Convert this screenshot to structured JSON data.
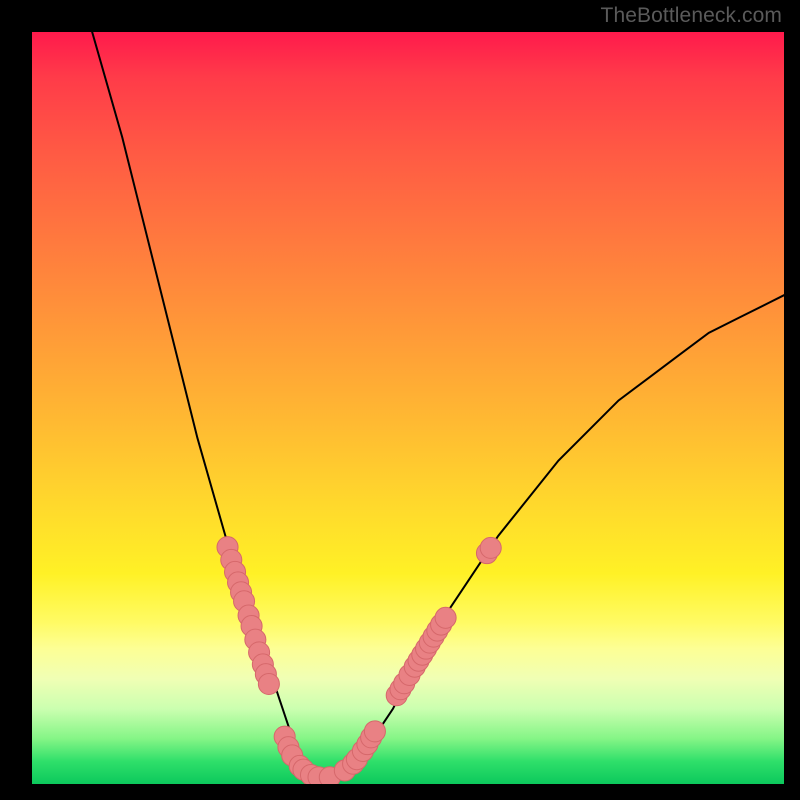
{
  "attribution": "TheBottleneck.com",
  "colors": {
    "frame": "#000000",
    "gradient_top": "#ff1a4c",
    "gradient_mid": "#ffe42a",
    "gradient_bottom": "#0cc95c",
    "curve": "#000000",
    "marker": "#e98184",
    "marker_stroke": "#d6686b"
  },
  "chart_data": {
    "type": "line",
    "title": "",
    "xlabel": "",
    "ylabel": "",
    "xlim": [
      0,
      100
    ],
    "ylim": [
      0,
      100
    ],
    "grid": false,
    "series": [
      {
        "name": "bottleneck-curve",
        "x": [
          8,
          10,
          12,
          14,
          16,
          18,
          20,
          22,
          24,
          26,
          27,
          28,
          29,
          30,
          31,
          32,
          33,
          34,
          35,
          36,
          37,
          38,
          39,
          40,
          42,
          44,
          46,
          48,
          50,
          54,
          58,
          62,
          66,
          70,
          74,
          78,
          82,
          86,
          90,
          94,
          98,
          100
        ],
        "y": [
          100,
          93,
          86,
          78,
          70,
          62,
          54,
          46,
          39,
          32,
          29,
          26,
          23,
          20,
          17,
          14,
          11,
          8,
          5,
          3,
          2,
          1,
          1,
          1,
          2,
          4,
          7,
          10,
          14,
          21,
          27,
          33,
          38,
          43,
          47,
          51,
          54,
          57,
          60,
          62,
          64,
          65
        ]
      }
    ],
    "markers": {
      "series_ref": "bottleneck-curve",
      "points": [
        {
          "x": 26.0,
          "y": 31.5,
          "r": 1.4
        },
        {
          "x": 26.5,
          "y": 29.8,
          "r": 1.4
        },
        {
          "x": 27.0,
          "y": 28.2,
          "r": 1.4
        },
        {
          "x": 27.4,
          "y": 26.8,
          "r": 1.4
        },
        {
          "x": 27.8,
          "y": 25.5,
          "r": 1.4
        },
        {
          "x": 28.2,
          "y": 24.3,
          "r": 1.4
        },
        {
          "x": 28.8,
          "y": 22.4,
          "r": 1.4
        },
        {
          "x": 29.2,
          "y": 21.0,
          "r": 1.4
        },
        {
          "x": 29.7,
          "y": 19.2,
          "r": 1.4
        },
        {
          "x": 30.2,
          "y": 17.5,
          "r": 1.4
        },
        {
          "x": 30.7,
          "y": 15.9,
          "r": 1.4
        },
        {
          "x": 31.1,
          "y": 14.6,
          "r": 1.4
        },
        {
          "x": 31.5,
          "y": 13.3,
          "r": 1.4
        },
        {
          "x": 33.6,
          "y": 6.3,
          "r": 1.4
        },
        {
          "x": 34.1,
          "y": 4.9,
          "r": 1.4
        },
        {
          "x": 34.6,
          "y": 3.8,
          "r": 1.4
        },
        {
          "x": 35.6,
          "y": 2.4,
          "r": 1.4
        },
        {
          "x": 36.1,
          "y": 1.9,
          "r": 1.4
        },
        {
          "x": 37.1,
          "y": 1.2,
          "r": 1.4
        },
        {
          "x": 38.1,
          "y": 0.9,
          "r": 1.4
        },
        {
          "x": 39.6,
          "y": 0.9,
          "r": 1.4
        },
        {
          "x": 41.6,
          "y": 1.8,
          "r": 1.4
        },
        {
          "x": 42.7,
          "y": 2.7,
          "r": 1.4
        },
        {
          "x": 43.2,
          "y": 3.3,
          "r": 1.4
        },
        {
          "x": 44.0,
          "y": 4.4,
          "r": 1.4
        },
        {
          "x": 44.6,
          "y": 5.3,
          "r": 1.4
        },
        {
          "x": 45.1,
          "y": 6.2,
          "r": 1.4
        },
        {
          "x": 45.6,
          "y": 7.0,
          "r": 1.4
        },
        {
          "x": 48.5,
          "y": 11.8,
          "r": 1.4
        },
        {
          "x": 49.0,
          "y": 12.6,
          "r": 1.4
        },
        {
          "x": 49.5,
          "y": 13.4,
          "r": 1.4
        },
        {
          "x": 50.2,
          "y": 14.5,
          "r": 1.4
        },
        {
          "x": 50.9,
          "y": 15.6,
          "r": 1.4
        },
        {
          "x": 51.4,
          "y": 16.4,
          "r": 1.4
        },
        {
          "x": 51.9,
          "y": 17.2,
          "r": 1.4
        },
        {
          "x": 52.4,
          "y": 18.0,
          "r": 1.4
        },
        {
          "x": 52.9,
          "y": 18.8,
          "r": 1.4
        },
        {
          "x": 53.4,
          "y": 19.6,
          "r": 1.4
        },
        {
          "x": 53.9,
          "y": 20.4,
          "r": 1.4
        },
        {
          "x": 54.4,
          "y": 21.2,
          "r": 1.4
        },
        {
          "x": 55.0,
          "y": 22.1,
          "r": 1.4
        },
        {
          "x": 60.5,
          "y": 30.7,
          "r": 1.4
        },
        {
          "x": 61.0,
          "y": 31.4,
          "r": 1.4
        }
      ]
    }
  }
}
